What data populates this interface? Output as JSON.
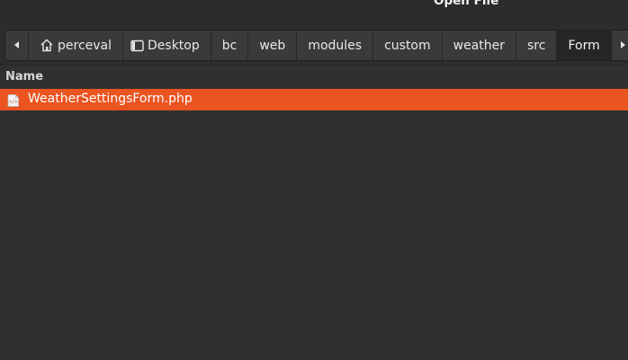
{
  "window": {
    "title": "Open File"
  },
  "pathbar": {
    "scroll_left_icon": "triangle-left-icon",
    "scroll_right_icon": "triangle-right-icon",
    "crumbs": [
      {
        "label": "perceval",
        "icon": "home-icon"
      },
      {
        "label": "Desktop",
        "icon": "desktop-icon"
      },
      {
        "label": "bc"
      },
      {
        "label": "web"
      },
      {
        "label": "modules"
      },
      {
        "label": "custom"
      },
      {
        "label": "weather"
      },
      {
        "label": "src"
      },
      {
        "label": "Form"
      }
    ]
  },
  "filelist": {
    "columns": [
      "Name"
    ],
    "rows": [
      {
        "name": "WeatherSettingsForm.php",
        "icon": "php-file-icon",
        "selected": true
      }
    ]
  },
  "colors": {
    "accent": "#e95420",
    "background": "#303030"
  }
}
